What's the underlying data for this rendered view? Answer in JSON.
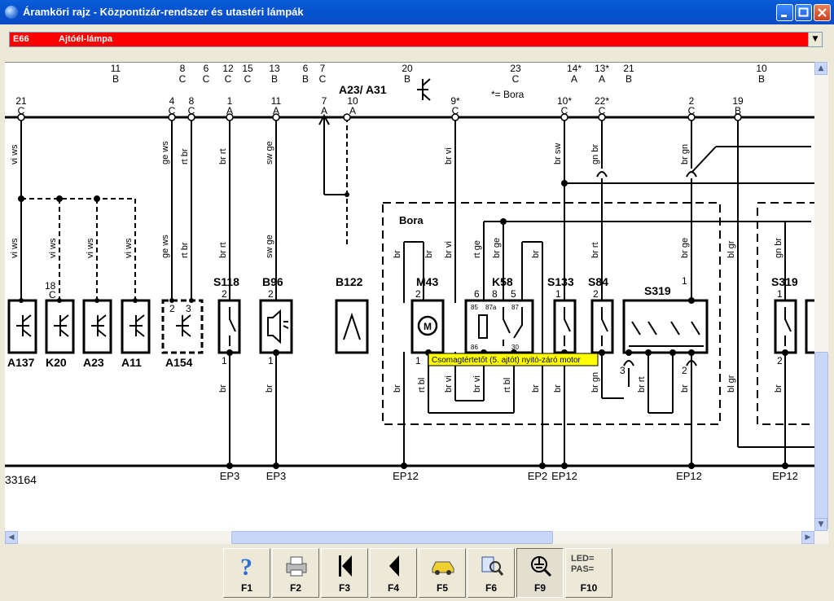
{
  "window": {
    "title": "Áramköri rajz - Központizár-rendszer és utastéri lámpák"
  },
  "selector": {
    "code": "E66",
    "label": "Ajtóél-lámpa"
  },
  "diagram": {
    "diagram_id": "33164",
    "tooltip": "Csomagtértetőt (5. ajtót) nyitó-záró motor",
    "legend_note": "*= Bora",
    "group_label": "A23/ A31",
    "box_label": "Bora",
    "top_refs": [
      {
        "num": "11",
        "letter": "B"
      },
      {
        "num": "8",
        "letter": "C"
      },
      {
        "num": "6",
        "letter": "C"
      },
      {
        "num": "12",
        "letter": "C"
      },
      {
        "num": "15",
        "letter": "C"
      },
      {
        "num": "13",
        "letter": "B"
      },
      {
        "num": "6",
        "letter": "B"
      },
      {
        "num": "7",
        "letter": "C"
      },
      {
        "num": "20",
        "letter": "B"
      },
      {
        "num": "23",
        "letter": "C"
      },
      {
        "num": "14*",
        "letter": "A"
      },
      {
        "num": "13*",
        "letter": "A"
      },
      {
        "num": "21",
        "letter": "B"
      },
      {
        "num": "10",
        "letter": "B"
      }
    ],
    "bus_pins": [
      {
        "num": "21",
        "letter": "C"
      },
      {
        "num": "4",
        "letter": "C"
      },
      {
        "num": "8",
        "letter": "C"
      },
      {
        "num": "1",
        "letter": "A"
      },
      {
        "num": "11",
        "letter": "A"
      },
      {
        "num": "7",
        "letter": "A"
      },
      {
        "num": "10",
        "letter": "A"
      },
      {
        "num": "9*",
        "letter": "C"
      },
      {
        "num": "10*",
        "letter": "C"
      },
      {
        "num": "22*",
        "letter": "C"
      },
      {
        "num": "2",
        "letter": "C"
      },
      {
        "num": "19",
        "letter": "B"
      }
    ],
    "wire_colors_upper": [
      "vi ws",
      "ge ws",
      "rt br",
      "br rt",
      "sw ge",
      "br vi",
      "br sw",
      "gn br",
      "br gn"
    ],
    "wire_colors_mid": [
      "vi ws",
      "vi ws",
      "vi ws",
      "vi ws",
      "ge ws",
      "rt br",
      "br rt",
      "sw ge",
      "br",
      "br vi",
      "br",
      "rt ge",
      "br ge",
      "br",
      "br rt",
      "br ge",
      "bl gr",
      "gn br"
    ],
    "wire_colors_lower": [
      "br",
      "br",
      "br",
      "rt bl",
      "br vi",
      "br vi",
      "rt bl",
      "br",
      "br gn",
      "br",
      "br rt",
      "br",
      "bl gr",
      "br"
    ],
    "components": [
      "A137",
      "K20",
      "A23",
      "A11",
      "A154",
      "S118",
      "B96",
      "B122",
      "M43",
      "K58",
      "S133",
      "S84",
      "S319",
      "S319"
    ],
    "pin_numbers": [
      "18",
      "2",
      "3",
      "2",
      "1",
      "2",
      "1",
      "2",
      "1",
      "6",
      "8",
      "5",
      "1",
      "2",
      "1",
      "3",
      "2",
      "1",
      "2"
    ],
    "relay_pins": [
      "85",
      "87a",
      "87",
      "86",
      "30"
    ],
    "connector_c_label": "C",
    "ground_points": [
      "EP3",
      "EP3",
      "EP12",
      "EP2",
      "EP12",
      "EP12",
      "EP12"
    ]
  },
  "toolbar": {
    "buttons": [
      {
        "key": "F1",
        "icon": "help-icon"
      },
      {
        "key": "F2",
        "icon": "printer-icon"
      },
      {
        "key": "F3",
        "icon": "first-page-icon"
      },
      {
        "key": "F4",
        "icon": "previous-page-icon"
      },
      {
        "key": "F5",
        "icon": "car-icon"
      },
      {
        "key": "F6",
        "icon": "component-search-icon"
      },
      {
        "key": "F9",
        "icon": "ground-point-search-icon"
      },
      {
        "key": "F10",
        "icon": "led-pas-icon",
        "icon_text": "LED= PAS="
      }
    ]
  }
}
